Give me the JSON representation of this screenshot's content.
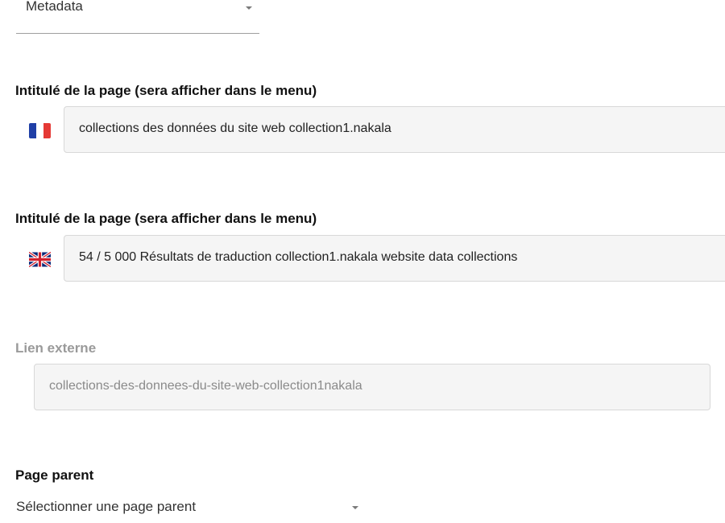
{
  "metadata_select": {
    "value": "Metadata"
  },
  "title_fr": {
    "label": "Intitulé de la page (sera afficher dans le menu)",
    "flag": "flag-france-icon",
    "value": "collections des données du site web collection1.nakala"
  },
  "title_en": {
    "label": "Intitulé de la page (sera afficher dans le menu)",
    "flag": "flag-uk-icon",
    "value": "54 / 5 000 Résultats de traduction collection1.nakala website data collections"
  },
  "external_link": {
    "label": "Lien externe",
    "value": "collections-des-donnees-du-site-web-collection1nakala"
  },
  "parent_page": {
    "label": "Page parent",
    "placeholder": "Sélectionner une page parent"
  },
  "colors": {
    "flag_blue": "#1f3fa6",
    "flag_red": "#e53935",
    "uk_blue": "#0b2a7a",
    "uk_red": "#d0202e"
  }
}
